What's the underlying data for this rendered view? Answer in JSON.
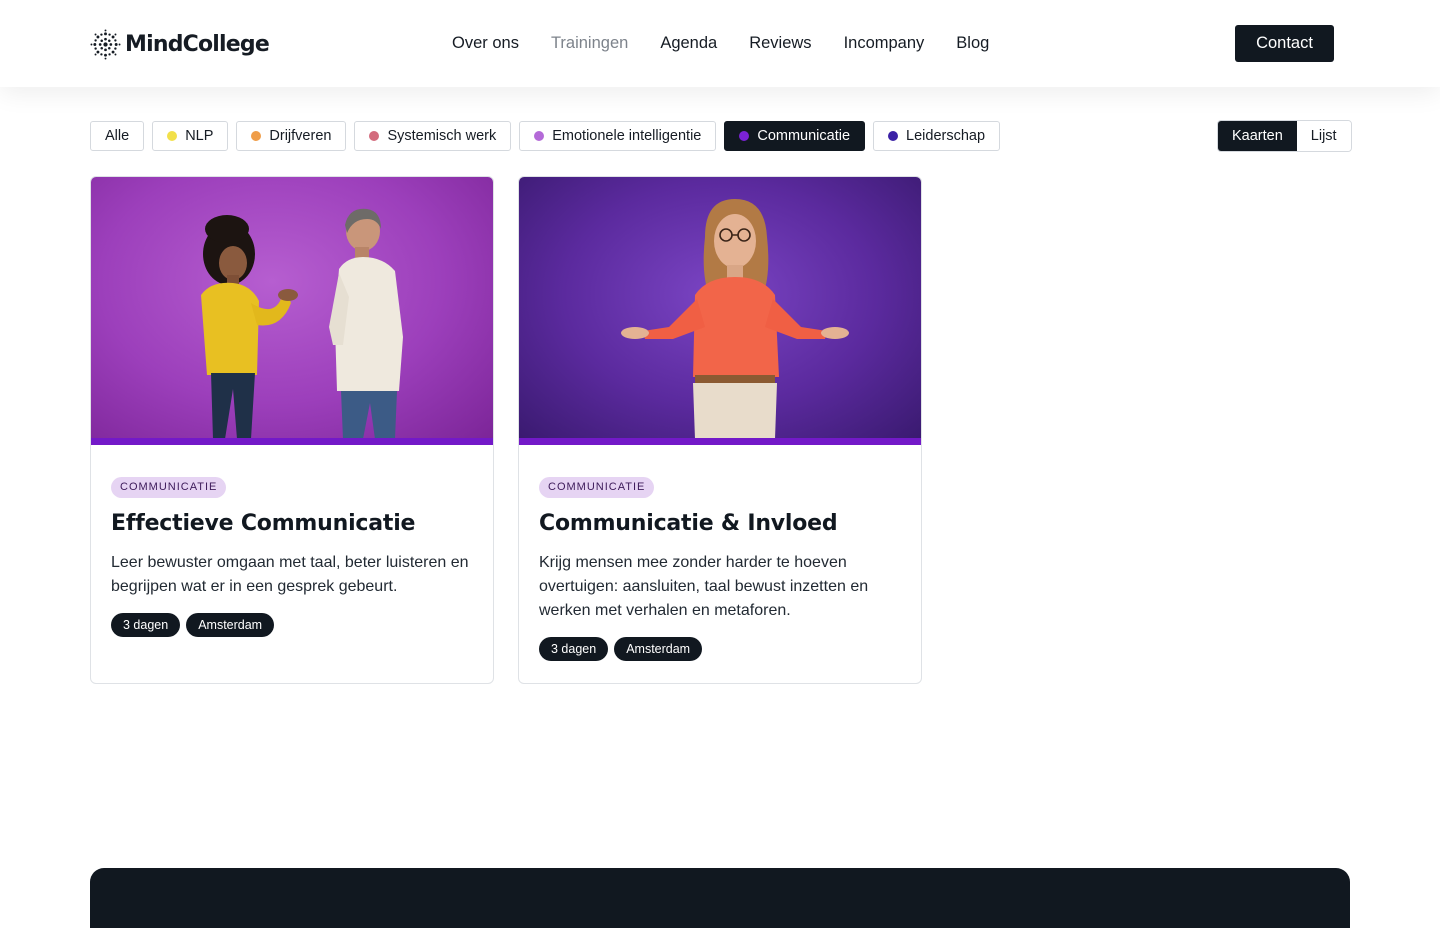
{
  "brand": {
    "name": "MindCollege"
  },
  "nav": {
    "items": [
      {
        "label": "Over ons",
        "active": false
      },
      {
        "label": "Trainingen",
        "active": true
      },
      {
        "label": "Agenda",
        "active": false
      },
      {
        "label": "Reviews",
        "active": false
      },
      {
        "label": "Incompany",
        "active": false
      },
      {
        "label": "Blog",
        "active": false
      }
    ],
    "contact_label": "Contact"
  },
  "filters": [
    {
      "label": "Alle",
      "color": null,
      "active": false
    },
    {
      "label": "NLP",
      "color": "#f2e04a",
      "active": false
    },
    {
      "label": "Drijfveren",
      "color": "#ef9d48",
      "active": false
    },
    {
      "label": "Systemisch werk",
      "color": "#d36b7d",
      "active": false
    },
    {
      "label": "Emotionele intelligentie",
      "color": "#b46ad8",
      "active": false
    },
    {
      "label": "Communicatie",
      "color": "#7b22d6",
      "active": true
    },
    {
      "label": "Leiderschap",
      "color": "#3b21a6",
      "active": false
    }
  ],
  "view_toggle": {
    "cards_label": "Kaarten",
    "list_label": "Lijst",
    "active": "cards"
  },
  "cards": [
    {
      "category": "COMMUNICATIE",
      "title": "Effectieve Communicatie",
      "description": "Leer bewuster omgaan met taal, beter luisteren en begrijpen wat er in een gesprek gebeurt.",
      "duration": "3 dagen",
      "location": "Amsterdam"
    },
    {
      "category": "COMMUNICATIE",
      "title": "Communicatie & Invloed",
      "description": "Krijg mensen mee zonder harder te hoeven overtuigen: aansluiten, taal bewust inzetten en werken met verhalen en metaforen.",
      "duration": "3 dagen",
      "location": "Amsterdam"
    }
  ],
  "colors": {
    "dark": "#111820",
    "accent_bar": "#7319c8",
    "tag_bg": "#e6d4f3"
  }
}
